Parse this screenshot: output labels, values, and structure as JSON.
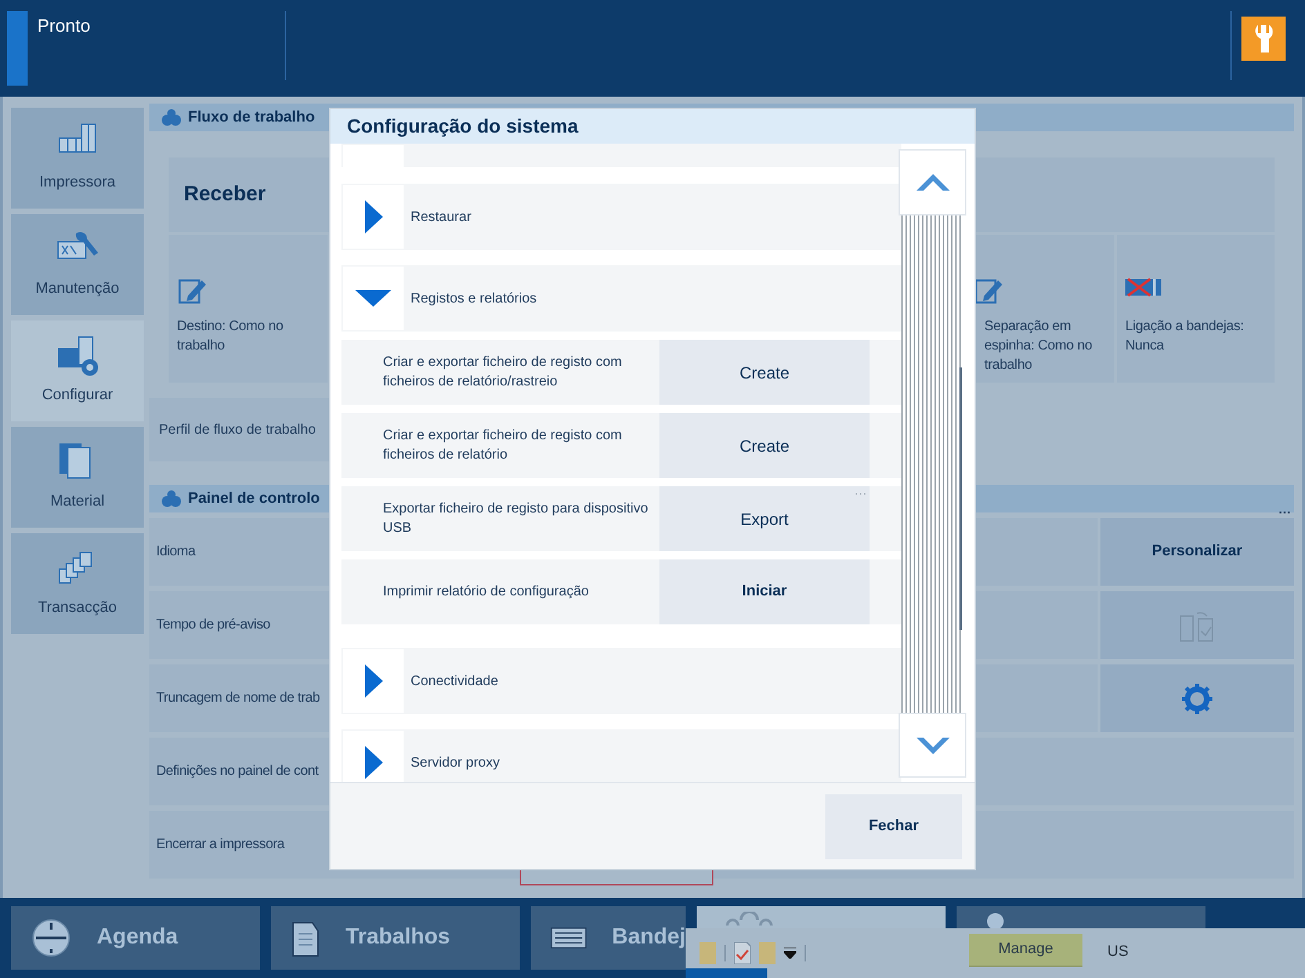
{
  "header": {
    "status": "Pronto"
  },
  "sidebar": {
    "items": [
      {
        "label": "Impressora",
        "selected": false
      },
      {
        "label": "Manutenção",
        "selected": false
      },
      {
        "label": "Configurar",
        "selected": true
      },
      {
        "label": "Material",
        "selected": false
      },
      {
        "label": "Transacção",
        "selected": false
      }
    ]
  },
  "workflow": {
    "title": "Fluxo de trabalho",
    "receive": "Receber",
    "cards": [
      {
        "text": "Destino: Como no trabalho"
      },
      {
        "text": "Separação em espinha: Como no trabalho"
      },
      {
        "text": "Ligação a bandejas: Nunca"
      }
    ],
    "profile": "Perfil de fluxo de trabalho"
  },
  "control_panel": {
    "title": "Painel de controlo",
    "rows": [
      {
        "label": "Idioma",
        "kind": "text",
        "value": "Personalizar",
        "more": "···"
      },
      {
        "label": "Tempo de pré-aviso",
        "kind": "doc"
      },
      {
        "label": "Truncagem de nome de trab",
        "kind": "gear"
      },
      {
        "label": "Definições no painel de cont",
        "kind": "none"
      },
      {
        "label": "Encerrar a impressora",
        "kind": "none"
      }
    ]
  },
  "dialog": {
    "title": "Configuração do sistema",
    "items": [
      {
        "kind": "partial"
      },
      {
        "kind": "section",
        "label": "Restaurar",
        "expanded": false
      },
      {
        "kind": "section",
        "label": "Registos e relatórios",
        "expanded": true
      },
      {
        "kind": "action",
        "label": "Criar e exportar ficheiro de registo com ficheiros de relatório/rastreio",
        "button": "Create",
        "bold": false
      },
      {
        "kind": "action",
        "label": "Criar e exportar ficheiro de registo com ficheiros de relatório",
        "button": "Create",
        "bold": false
      },
      {
        "kind": "action",
        "label": "Exportar ficheiro de registo para dispositivo USB",
        "button": "Export",
        "more": "···",
        "bold": false
      },
      {
        "kind": "action",
        "label": "Imprimir relatório de configuração",
        "button": "Iniciar",
        "bold": true
      },
      {
        "kind": "section",
        "label": "Conectividade",
        "expanded": false
      },
      {
        "kind": "section",
        "label": "Servidor proxy",
        "expanded": false
      }
    ],
    "close": "Fechar"
  },
  "bottom_nav": [
    {
      "label": "Agenda",
      "selected": false
    },
    {
      "label": "Trabalhos",
      "selected": false
    },
    {
      "label": "Bandej",
      "selected": false
    },
    {
      "selected": true
    },
    {
      "selected": false
    }
  ],
  "taskbar": {
    "tab": "Manage",
    "locale": "US"
  }
}
